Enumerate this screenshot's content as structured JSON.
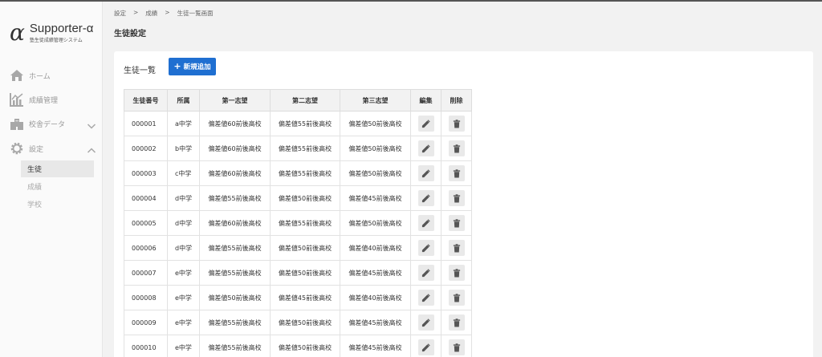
{
  "app": {
    "logo_symbol": "α",
    "title": "Supporter-α",
    "subtitle": "塾生徒成績管理システム"
  },
  "sidebar": {
    "items": [
      {
        "label": "ホーム",
        "icon": "home-icon"
      },
      {
        "label": "成績管理",
        "icon": "chart-icon"
      },
      {
        "label": "校舎データ",
        "icon": "building-icon",
        "expanded": false
      },
      {
        "label": "設定",
        "icon": "gear-icon",
        "expanded": true
      }
    ],
    "sub_items": [
      {
        "label": "生徒",
        "active": true
      },
      {
        "label": "成績",
        "active": false
      },
      {
        "label": "学校",
        "active": false
      }
    ]
  },
  "breadcrumb": [
    "設定",
    ">",
    "成績",
    ">",
    "生徒一覧画面"
  ],
  "page_title": "生徒設定",
  "list": {
    "title": "生徒一覧",
    "add_button_icon": "+",
    "add_button_label": "新規追加"
  },
  "table": {
    "headers": [
      "生徒番号",
      "所属",
      "第一志望",
      "第二志望",
      "第三志望",
      "編集",
      "削除"
    ],
    "rows": [
      {
        "id": "000001",
        "school": "a中学",
        "first": "偏差値60前後高校",
        "second": "偏差値55前後高校",
        "third": "偏差値50前後高校"
      },
      {
        "id": "000002",
        "school": "b中学",
        "first": "偏差値60前後高校",
        "second": "偏差値55前後高校",
        "third": "偏差値50前後高校"
      },
      {
        "id": "000003",
        "school": "c中学",
        "first": "偏差値60前後高校",
        "second": "偏差値55前後高校",
        "third": "偏差値50前後高校"
      },
      {
        "id": "000004",
        "school": "d中学",
        "first": "偏差値55前後高校",
        "second": "偏差値50前後高校",
        "third": "偏差値45前後高校"
      },
      {
        "id": "000005",
        "school": "d中学",
        "first": "偏差値60前後高校",
        "second": "偏差値55前後高校",
        "third": "偏差値50前後高校"
      },
      {
        "id": "000006",
        "school": "d中学",
        "first": "偏差値55前後高校",
        "second": "偏差値50前後高校",
        "third": "偏差値40前後高校"
      },
      {
        "id": "000007",
        "school": "e中学",
        "first": "偏差値55前後高校",
        "second": "偏差値50前後高校",
        "third": "偏差値45前後高校"
      },
      {
        "id": "000008",
        "school": "e中学",
        "first": "偏差値50前後高校",
        "second": "偏差値45前後高校",
        "third": "偏差値40前後高校"
      },
      {
        "id": "000009",
        "school": "e中学",
        "first": "偏差値55前後高校",
        "second": "偏差値50前後高校",
        "third": "偏差値45前後高校"
      },
      {
        "id": "000010",
        "school": "e中学",
        "first": "偏差値55前後高校",
        "second": "偏差値50前後高校",
        "third": "偏差値45前後高校"
      }
    ]
  },
  "colors": {
    "primary": "#1f6fd1",
    "sidebar_icon": "#a8a8a8",
    "action_icon": "#555555"
  }
}
